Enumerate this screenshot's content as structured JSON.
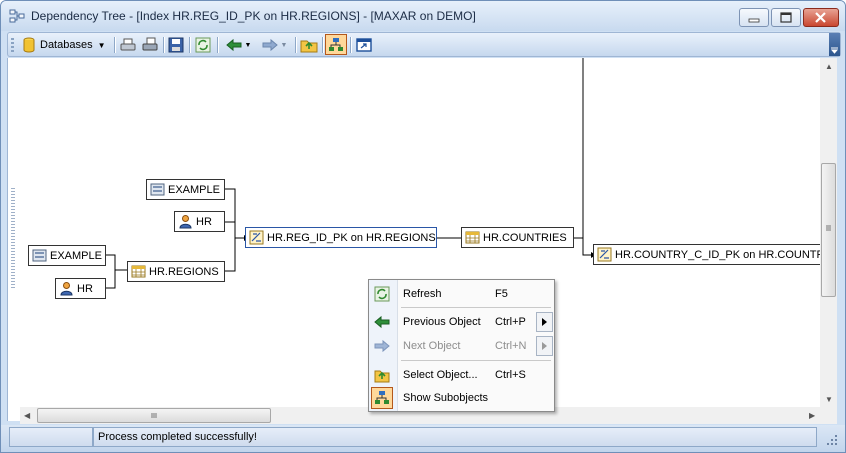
{
  "window": {
    "title": "Dependency Tree - [Index HR.REG_ID_PK on HR.REGIONS] - [MAXAR on DEMO]",
    "app_icon": "dependency-tree-icon",
    "controls": [
      "minimize-icon",
      "maximize-icon",
      "close-icon"
    ]
  },
  "toolbar": {
    "databases_label": "Databases",
    "buttons": [
      "databases-icon",
      "print-icon",
      "print-preview-icon",
      "save-icon",
      "refresh-icon",
      "previous-object-icon",
      "next-object-icon",
      "select-object-icon",
      "show-subobjects-icon",
      "new-window-icon"
    ]
  },
  "tree": {
    "nodes": {
      "example_left": "EXAMPLE",
      "hr_left": "HR",
      "regions": "HR.REGIONS",
      "example_top": "EXAMPLE",
      "hr_top": "HR",
      "reg_id_pk": "HR.REG_ID_PK on HR.REGIONS",
      "countries": "HR.COUNTRIES",
      "country_c_id_pk": "HR.COUNTRY_C_ID_PK on HR.COUNTRIES"
    }
  },
  "context_menu": {
    "items": [
      {
        "label": "Refresh",
        "shortcut": "F5",
        "icon": "refresh-icon",
        "enabled": true
      },
      {
        "label": "Previous Object",
        "shortcut": "Ctrl+P",
        "icon": "previous-object-icon",
        "enabled": true
      },
      {
        "label": "Next Object",
        "shortcut": "Ctrl+N",
        "icon": "next-object-icon",
        "enabled": false
      },
      {
        "label": "Select Object...",
        "shortcut": "Ctrl+S",
        "icon": "select-object-icon",
        "enabled": true
      },
      {
        "label": "Show Subobjects",
        "shortcut": "",
        "icon": "show-subobjects-icon",
        "enabled": true
      }
    ]
  },
  "statusbar": {
    "message": "Process completed successfully!"
  },
  "colors": {
    "titlebar": "#c8daef",
    "selected_border": "#2a56a6",
    "close_button": "#c94730"
  }
}
